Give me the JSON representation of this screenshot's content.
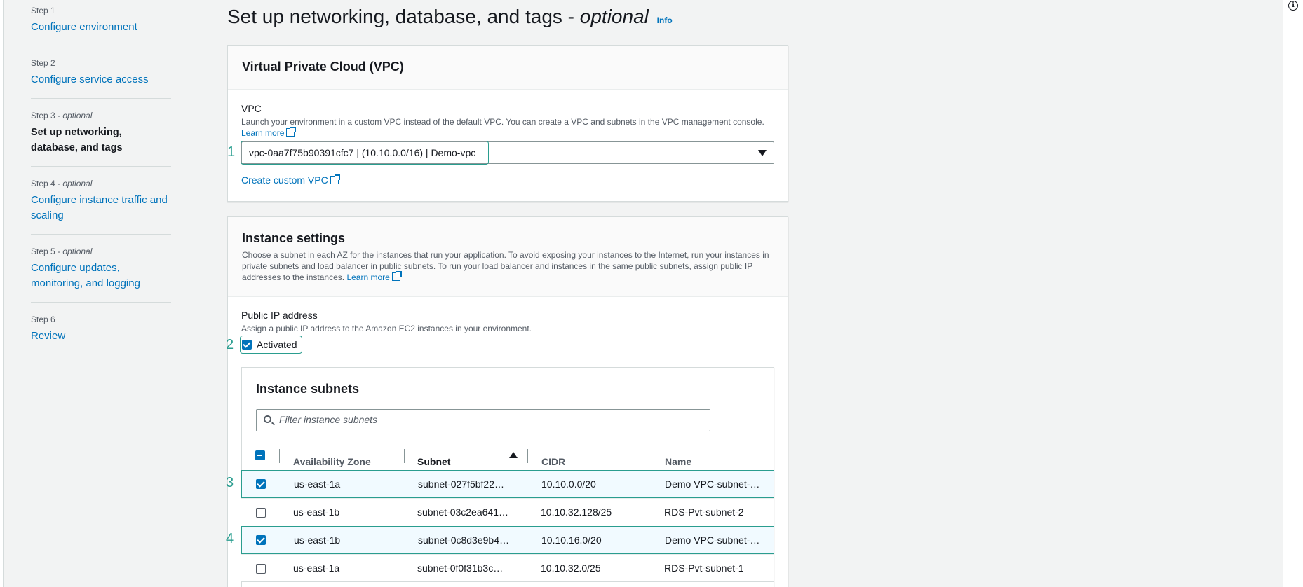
{
  "steps": [
    {
      "num": "Step 1",
      "suffix": "",
      "title": "Configure environment"
    },
    {
      "num": "Step 2",
      "suffix": "",
      "title": "Configure service access"
    },
    {
      "num": "Step 3 - ",
      "suffix": "optional",
      "title": "Set up networking, database, and tags"
    },
    {
      "num": "Step 4 - ",
      "suffix": "optional",
      "title": "Configure instance traffic and scaling"
    },
    {
      "num": "Step 5 - ",
      "suffix": "optional",
      "title": "Configure updates, monitoring, and logging"
    },
    {
      "num": "Step 6",
      "suffix": "",
      "title": "Review"
    }
  ],
  "page": {
    "title_main": "Set up networking, database, and tags - ",
    "title_optional": "optional",
    "info": "Info"
  },
  "vpc_card": {
    "title": "Virtual Private Cloud (VPC)",
    "label": "VPC",
    "description": "Launch your environment in a custom VPC instead of the default VPC. You can create a VPC and subnets in the VPC management console.",
    "learn_more": "Learn more",
    "selected_value": "vpc-0aa7f75b90391cfc7 | (10.10.0.0/16) | Demo-vpc",
    "create_link": "Create custom VPC"
  },
  "instance_card": {
    "title": "Instance settings",
    "description": "Choose a subnet in each AZ for the instances that run your application. To avoid exposing your instances to the Internet, run your instances in private subnets and load balancer in public subnets. To run your load balancer and instances in the same public subnets, assign public IP addresses to the instances.",
    "learn_more": "Learn more",
    "public_ip_label": "Public IP address",
    "public_ip_desc": "Assign a public IP address to the Amazon EC2 instances in your environment.",
    "activated_label": "Activated",
    "activated_checked": true
  },
  "subnets": {
    "title": "Instance subnets",
    "filter_placeholder": "Filter instance subnets",
    "columns": [
      "Availability Zone",
      "Subnet",
      "CIDR",
      "Name"
    ],
    "sort_column": "Subnet",
    "sort_direction": "ascending",
    "rows": [
      {
        "checked": true,
        "az": "us-east-1a",
        "subnet": "subnet-027f5bf22…",
        "cidr": "10.10.0.0/20",
        "name": "Demo VPC-subnet-…"
      },
      {
        "checked": false,
        "az": "us-east-1b",
        "subnet": "subnet-03c2ea641…",
        "cidr": "10.10.32.128/25",
        "name": "RDS-Pvt-subnet-2"
      },
      {
        "checked": true,
        "az": "us-east-1b",
        "subnet": "subnet-0c8d3e9b4…",
        "cidr": "10.10.16.0/20",
        "name": "Demo VPC-subnet-…"
      },
      {
        "checked": false,
        "az": "us-east-1a",
        "subnet": "subnet-0f0f31b3c…",
        "cidr": "10.10.32.0/25",
        "name": "RDS-Pvt-subnet-1"
      }
    ]
  },
  "markers": [
    "1",
    "2",
    "3",
    "4"
  ],
  "colors": {
    "accent": "#0073bb",
    "highlight": "#2a9d8f",
    "background": "#f2f3f3"
  }
}
